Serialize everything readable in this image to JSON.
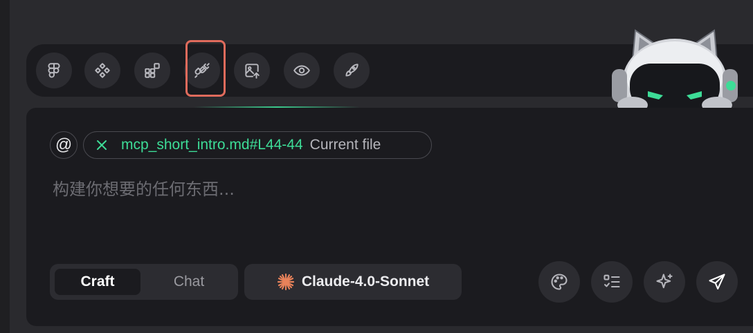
{
  "toolbar": {
    "tools": [
      {
        "name": "figma-icon"
      },
      {
        "name": "components-icon"
      },
      {
        "name": "widgets-icon"
      },
      {
        "name": "plug-icon",
        "highlighted": true
      },
      {
        "name": "image-upload-icon"
      },
      {
        "name": "eye-icon"
      },
      {
        "name": "rocket-icon"
      }
    ]
  },
  "context": {
    "mention_symbol": "@",
    "file_name": "mcp_short_intro.md#L44-44",
    "file_tag": "Current file"
  },
  "input": {
    "placeholder": "构建你想要的任何东西...",
    "value": ""
  },
  "mode": {
    "options": [
      "Craft",
      "Chat"
    ],
    "selected": "Craft"
  },
  "model": {
    "label": "Claude-4.0-Sonnet",
    "icon": "claude-sunburst-icon"
  },
  "actions": [
    {
      "name": "palette-icon"
    },
    {
      "name": "checklist-icon"
    },
    {
      "name": "sparkle-icon"
    },
    {
      "name": "send-icon"
    }
  ],
  "colors": {
    "accent_green": "#3ddc97",
    "highlight_red": "#e06b5c",
    "claude_orange": "#e8825a",
    "background": "#2a2a2e",
    "panel": "#1b1b1f"
  }
}
